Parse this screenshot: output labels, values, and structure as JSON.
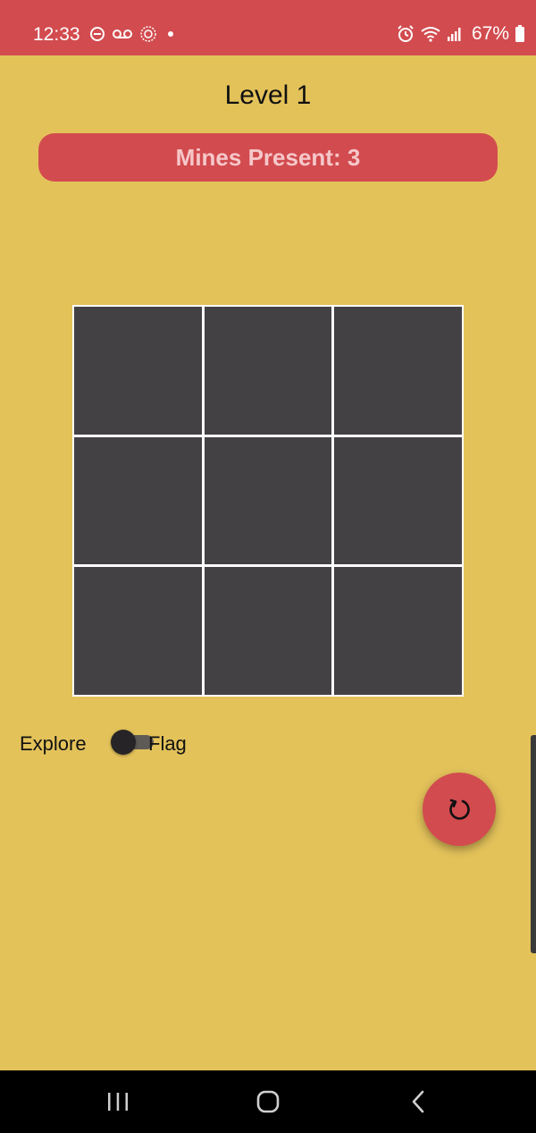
{
  "status_bar": {
    "time": "12:33",
    "battery": "67%",
    "icons": [
      "do-not-disturb-icon",
      "voicemail-icon",
      "sun-icon",
      "dot-icon",
      "alarm-icon",
      "wifi-icon",
      "signal-icon",
      "battery-icon"
    ],
    "color": "#d24b4f"
  },
  "game": {
    "level_title": "Level 1",
    "mines_label": "Mines Present: 3",
    "grid": {
      "rows": 3,
      "cols": 3,
      "cell_color": "#434144"
    }
  },
  "mode_toggle": {
    "left_label": "Explore",
    "right_label": "Flag",
    "state": "explore"
  },
  "fab": {
    "icon": "refresh-icon"
  },
  "nav_bar": {
    "icons": [
      "recent-apps-icon",
      "home-icon",
      "back-icon"
    ]
  },
  "colors": {
    "background": "#e3c25a",
    "accent": "#d24b4f",
    "banner_text": "#f6c7c9"
  }
}
